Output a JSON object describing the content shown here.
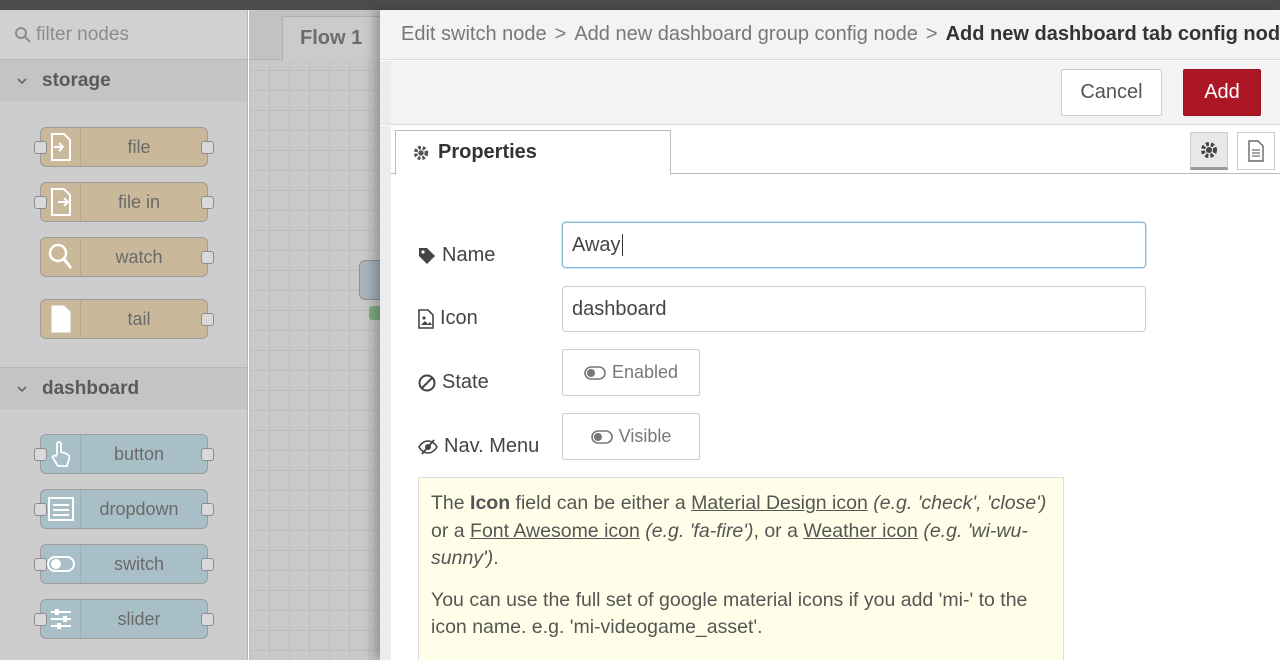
{
  "palette": {
    "filter_placeholder": "filter nodes",
    "categories": [
      {
        "name": "storage",
        "nodes": [
          "file",
          "file in",
          "watch",
          "tail"
        ]
      },
      {
        "name": "dashboard",
        "nodes": [
          "button",
          "dropdown",
          "switch",
          "slider"
        ]
      }
    ]
  },
  "workspace": {
    "tab": "Flow 1"
  },
  "tray": {
    "breadcrumb": [
      "Edit switch node",
      "Add new dashboard group config node",
      "Add new dashboard tab config node"
    ],
    "breadcrumb_sep": ">",
    "cancel": "Cancel",
    "add": "Add",
    "properties_tab": "Properties",
    "fields": {
      "name_label": "Name",
      "name_value": "Away",
      "icon_label": "Icon",
      "icon_value": "dashboard",
      "state_label": "State",
      "state_value": "Enabled",
      "nav_label": "Nav. Menu",
      "nav_value": "Visible"
    },
    "help": {
      "p1_a": "The ",
      "p1_icon": "Icon",
      "p1_b": " field can be either a ",
      "link_material": "Material Design icon",
      "p1_c": " (e.g. 'check', 'close')",
      "p1_d": " or a ",
      "link_fa": "Font Awesome icon",
      "p1_e": " (e.g. 'fa-fire')",
      "p1_f": ", or a ",
      "link_weather": "Weather icon",
      "p1_g": " (e.g. 'wi-wu-sunny')",
      "p1_h": ".",
      "p2": "You can use the full set of google material icons if you add 'mi-' to the icon name. e.g. 'mi-videogame_asset'."
    }
  },
  "colors": {
    "add_button": "#ad1625",
    "storage_node": "#c9b99a",
    "dashboard_node": "#a9bfc8",
    "help_bg": "#ffffe9"
  }
}
